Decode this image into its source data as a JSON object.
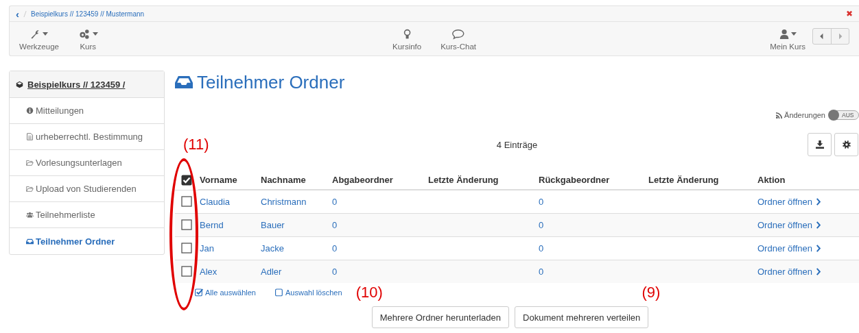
{
  "breadcrumb": {
    "back": "‹",
    "path": "Beispielkurs // 123459 // Mustermann",
    "close": "✖"
  },
  "toolbar": {
    "left": [
      {
        "label": "Werkzeuge",
        "dropdown": true
      },
      {
        "label": "Kurs",
        "dropdown": true
      }
    ],
    "center": [
      {
        "label": "Kursinfo",
        "dropdown": false
      },
      {
        "label": "Kurs-Chat",
        "dropdown": false
      }
    ],
    "right": [
      {
        "label": "Mein Kurs",
        "dropdown": true
      }
    ]
  },
  "sidebar": {
    "title": "Beispielkurs // 123459 /",
    "items": [
      {
        "label": "Mitteilungen",
        "selected": false
      },
      {
        "label": "urheberrechtl. Bestimmung",
        "selected": false
      },
      {
        "label": "Vorlesungsunterlagen",
        "selected": false
      },
      {
        "label": "Upload von Studierenden",
        "selected": false
      },
      {
        "label": "Teilnehmerliste",
        "selected": false
      },
      {
        "label": "Teilnehmer Ordner",
        "selected": true
      }
    ]
  },
  "page_title": "Teilnehmer Ordner",
  "changes_toggle": {
    "label": "Änderungen",
    "state_text": "AUS",
    "on": false
  },
  "entry_count": "4 Einträge",
  "table": {
    "select_all_checked": true,
    "checkbox_column_highlighted": true,
    "columns": [
      "Vorname",
      "Nachname",
      "Abgabeordner",
      "Letzte Änderung",
      "Rückgabeordner",
      "Letzte Änderung",
      "Aktion"
    ],
    "rows": [
      {
        "checked": false,
        "cells": [
          "Claudia",
          "Christmann",
          "0",
          "",
          "0",
          "",
          "Ordner öffnen"
        ]
      },
      {
        "checked": false,
        "cells": [
          "Bernd",
          "Bauer",
          "0",
          "",
          "0",
          "",
          "Ordner öffnen"
        ]
      },
      {
        "checked": false,
        "cells": [
          "Jan",
          "Jacke",
          "0",
          "",
          "0",
          "",
          "Ordner öffnen"
        ]
      },
      {
        "checked": false,
        "cells": [
          "Alex",
          "Adler",
          "0",
          "",
          "0",
          "",
          "Ordner öffnen"
        ]
      }
    ]
  },
  "selection_links": [
    {
      "label": "Alle auswählen",
      "checked": true
    },
    {
      "label": "Auswahl löschen",
      "checked": false
    }
  ],
  "buttons": [
    "Mehrere Ordner herunterladen",
    "Dokument mehreren verteilen"
  ],
  "annotations": [
    "(11)",
    "(10)",
    "(9)"
  ]
}
